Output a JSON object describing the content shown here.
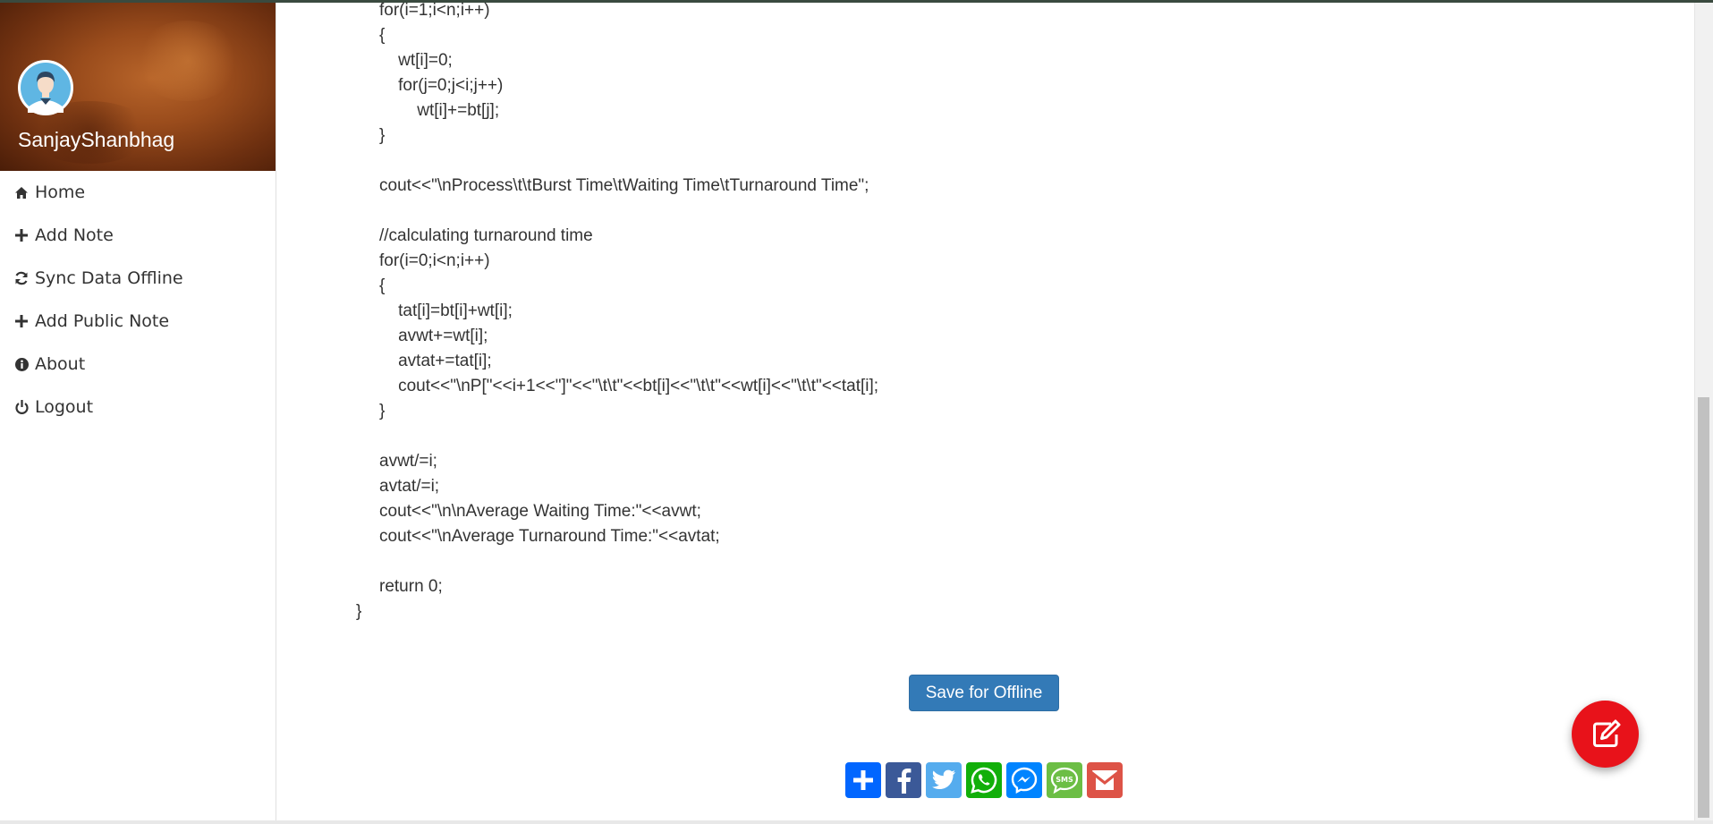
{
  "sidebar": {
    "username": "SanjayShanbhag",
    "items": [
      {
        "label": "Home",
        "icon": "home-icon"
      },
      {
        "label": "Add Note",
        "icon": "plus-icon"
      },
      {
        "label": "Sync Data Offline",
        "icon": "refresh-icon"
      },
      {
        "label": "Add Public Note",
        "icon": "plus-icon"
      },
      {
        "label": "About",
        "icon": "info-icon"
      },
      {
        "label": "Logout",
        "icon": "power-icon"
      }
    ]
  },
  "code": {
    "lines": [
      "for(i=1;i<n;i++)",
      "{",
      "    wt[i]=0;",
      "    for(j=0;j<i;j++)",
      "        wt[i]+=bt[j];",
      "}",
      "",
      "cout<<\"\\nProcess\\t\\tBurst Time\\tWaiting Time\\tTurnaround Time\";",
      "",
      "//calculating turnaround time",
      "for(i=0;i<n;i++)",
      "{",
      "    tat[i]=bt[i]+wt[i];",
      "    avwt+=wt[i];",
      "    avtat+=tat[i];",
      "    cout<<\"\\nP[\"<<i+1<<\"]\"<<\"\\t\\t\"<<bt[i]<<\"\\t\\t\"<<wt[i]<<\"\\t\\t\"<<tat[i];",
      "}",
      "",
      "avwt/=i;",
      "avtat/=i;",
      "cout<<\"\\n\\nAverage Waiting Time:\"<<avwt;",
      "cout<<\"\\nAverage Turnaround Time:\"<<avtat;",
      "",
      "return 0;",
      "}"
    ]
  },
  "save_button": "Save for Offline",
  "share_icons": [
    "share-plus-icon",
    "facebook-icon",
    "twitter-icon",
    "whatsapp-icon",
    "messenger-icon",
    "sms-icon",
    "gmail-icon"
  ],
  "colors": {
    "primary": "#337ab7",
    "fab": "#e8121a"
  }
}
